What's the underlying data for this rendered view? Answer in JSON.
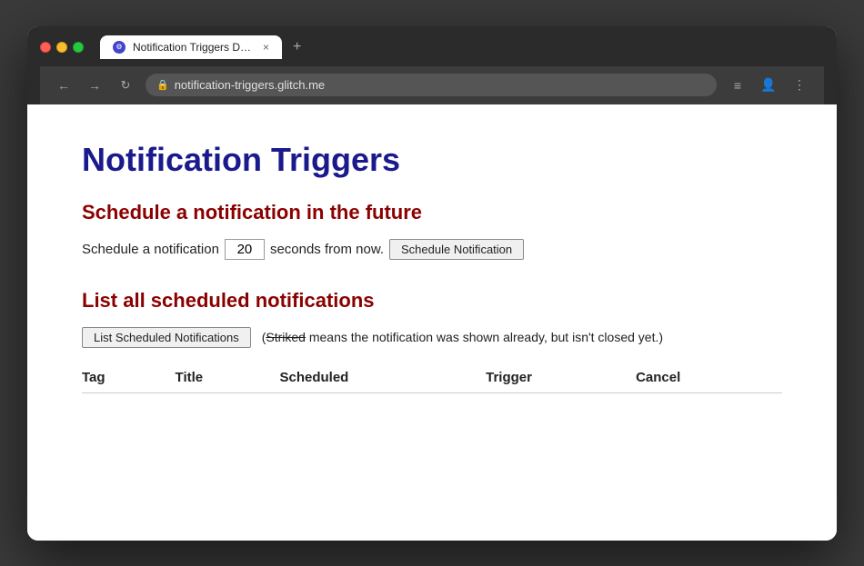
{
  "browser": {
    "tab": {
      "title": "Notification Triggers Demo",
      "favicon_char": "⚙"
    },
    "tab_close": "×",
    "new_tab": "+",
    "url": "notification-triggers.glitch.me",
    "nav": {
      "back": "←",
      "forward": "→",
      "reload": "↻"
    },
    "addr_icons": {
      "list": "≡",
      "account": "👤",
      "menu": "⋮"
    }
  },
  "page": {
    "title": "Notification Triggers",
    "section1": {
      "heading": "Schedule a notification in the future",
      "label_before": "Schedule a notification",
      "seconds_value": "20",
      "label_after": "seconds from now.",
      "button_label": "Schedule Notification"
    },
    "section2": {
      "heading": "List all scheduled notifications",
      "button_label": "List Scheduled Notifications",
      "note_before": "(",
      "note_striked": "Striked",
      "note_after": " means the notification was shown already, but isn't closed yet.)",
      "table": {
        "columns": [
          "Tag",
          "Title",
          "Scheduled",
          "Trigger",
          "Cancel"
        ],
        "rows": []
      }
    }
  }
}
